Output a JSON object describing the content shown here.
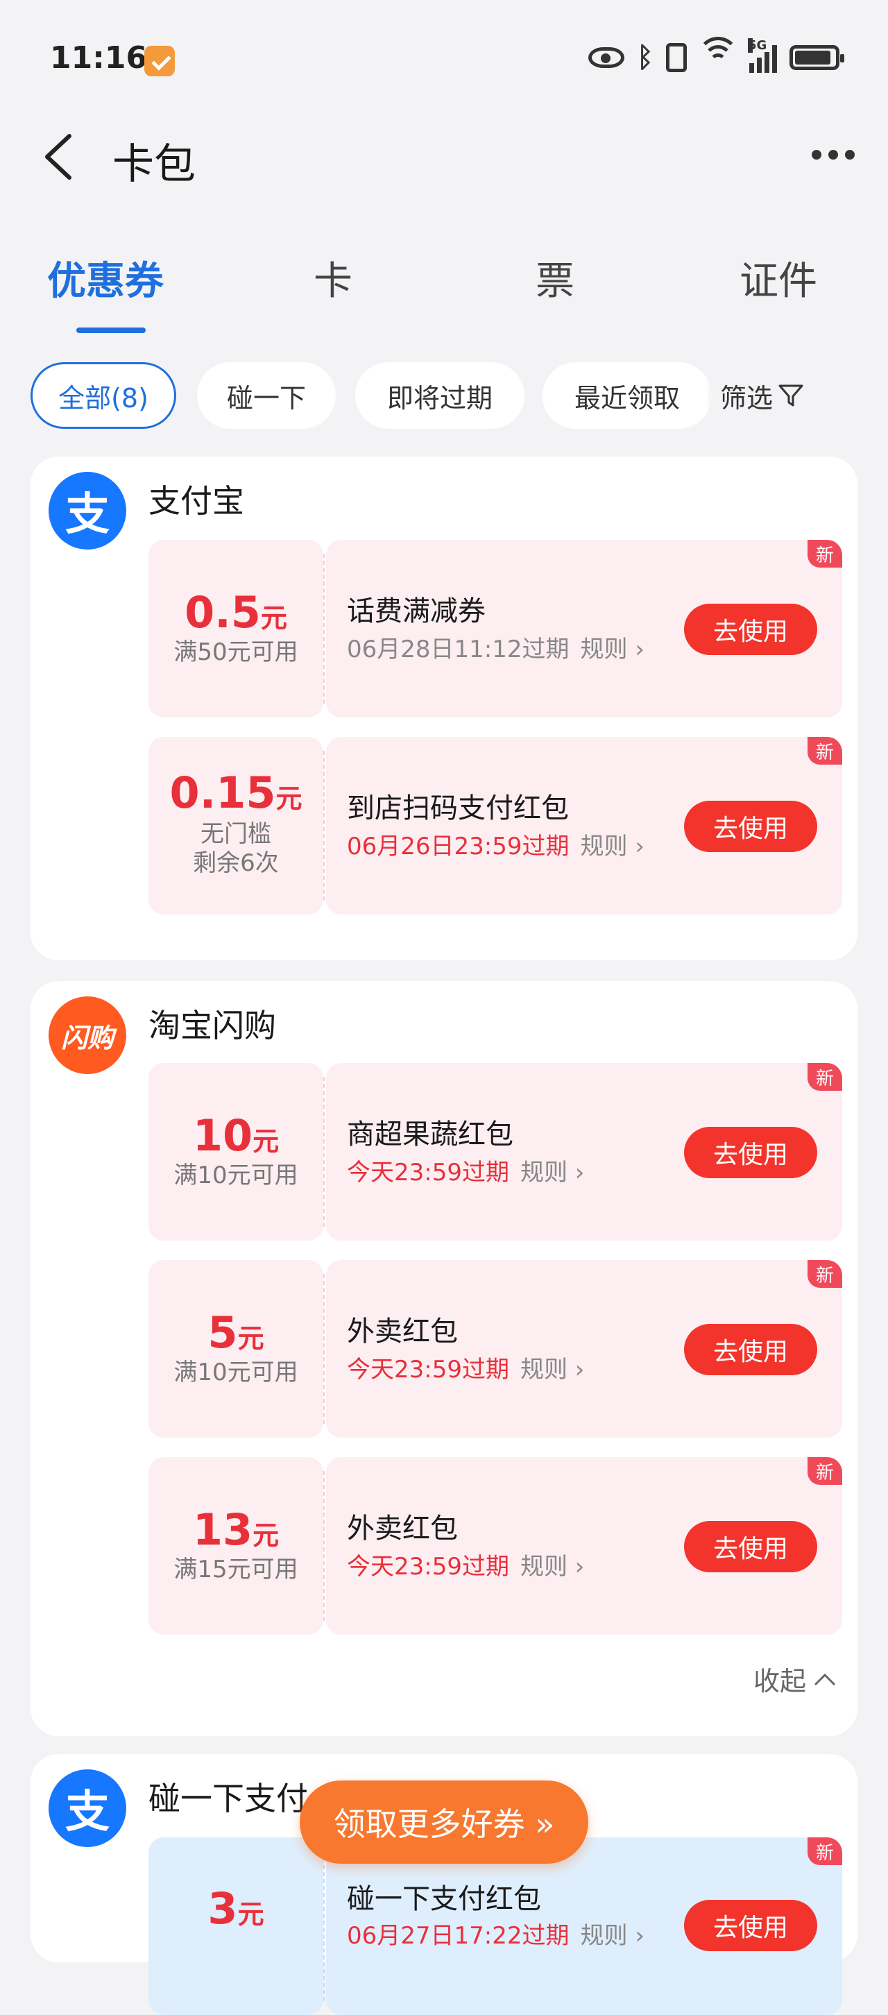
{
  "status_bar": {
    "time": "11:16",
    "network": "5G"
  },
  "header": {
    "title": "卡包"
  },
  "tabs": [
    "优惠券",
    "卡",
    "票",
    "证件"
  ],
  "chips": [
    "全部(8)",
    "碰一下",
    "即将过期",
    "最近领取"
  ],
  "filter_label": "筛选",
  "groups": [
    {
      "brand": "支付宝",
      "logo_text": "支",
      "coupons": [
        {
          "amount": "0.5",
          "unit": "元",
          "cond": [
            "满50元可用"
          ],
          "title": "话费满减券",
          "expire": "06月28日11:12过期",
          "rule": "规则",
          "button": "去使用",
          "badge": "新"
        },
        {
          "amount": "0.15",
          "unit": "元",
          "cond": [
            "无门槛",
            "剩余6次"
          ],
          "title": "到店扫码支付红包",
          "expire": "06月26日23:59过期",
          "rule": "规则",
          "button": "去使用",
          "badge": "新"
        }
      ]
    },
    {
      "brand": "淘宝闪购",
      "logo_text": "闪购",
      "coupons": [
        {
          "amount": "10",
          "unit": "元",
          "cond": [
            "满10元可用"
          ],
          "title": "商超果蔬红包",
          "expire": "今天23:59过期",
          "rule": "规则",
          "button": "去使用",
          "badge": "新"
        },
        {
          "amount": "5",
          "unit": "元",
          "cond": [
            "满10元可用"
          ],
          "title": "外卖红包",
          "expire": "今天23:59过期",
          "rule": "规则",
          "button": "去使用",
          "badge": "新"
        },
        {
          "amount": "13",
          "unit": "元",
          "cond": [
            "满15元可用"
          ],
          "title": "外卖红包",
          "expire": "今天23:59过期",
          "rule": "规则",
          "button": "去使用",
          "badge": "新"
        }
      ],
      "collapse_label": "收起"
    },
    {
      "brand": "碰一下支付",
      "logo_text": "支",
      "coupons": [
        {
          "amount": "3",
          "unit": "元",
          "title": "碰一下支付红包",
          "expire": "06月27日17:22过期",
          "rule": "规则",
          "button": "去使用",
          "badge": "新"
        }
      ]
    }
  ],
  "float_button": "领取更多好券 »",
  "colors": {
    "accent": "#1f6fde",
    "red": "#e8303a",
    "button": "#f2342c",
    "float": "#f7782e"
  }
}
